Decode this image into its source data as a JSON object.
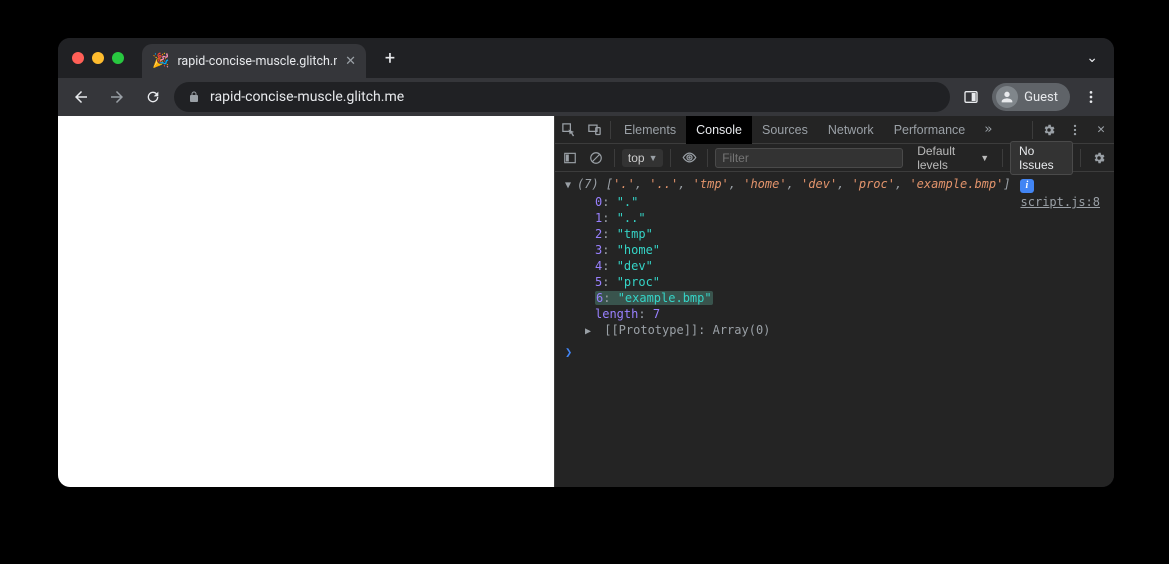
{
  "tab": {
    "title": "rapid-concise-muscle.glitch.m",
    "favicon": "🎉"
  },
  "toolbar": {
    "url": "rapid-concise-muscle.glitch.me",
    "guest": "Guest"
  },
  "devtools": {
    "tabs": [
      "Elements",
      "Console",
      "Sources",
      "Network",
      "Performance"
    ],
    "active_tab": "Console",
    "context": "top",
    "filter_placeholder": "Filter",
    "levels": "Default levels",
    "issues": "No Issues",
    "source_link": "script.js:8"
  },
  "console": {
    "array_count": "(7)",
    "preview": [
      "'.'",
      "'..'",
      "'tmp'",
      "'home'",
      "'dev'",
      "'proc'",
      "'example.bmp'"
    ],
    "items": [
      {
        "index": "0",
        "value": "\".\""
      },
      {
        "index": "1",
        "value": "\"..\""
      },
      {
        "index": "2",
        "value": "\"tmp\""
      },
      {
        "index": "3",
        "value": "\"home\""
      },
      {
        "index": "4",
        "value": "\"dev\""
      },
      {
        "index": "5",
        "value": "\"proc\""
      },
      {
        "index": "6",
        "value": "\"example.bmp\"",
        "highlighted": true
      }
    ],
    "length_label": "length",
    "length_value": "7",
    "proto_label": "[[Prototype]]",
    "proto_value": "Array(0)"
  }
}
